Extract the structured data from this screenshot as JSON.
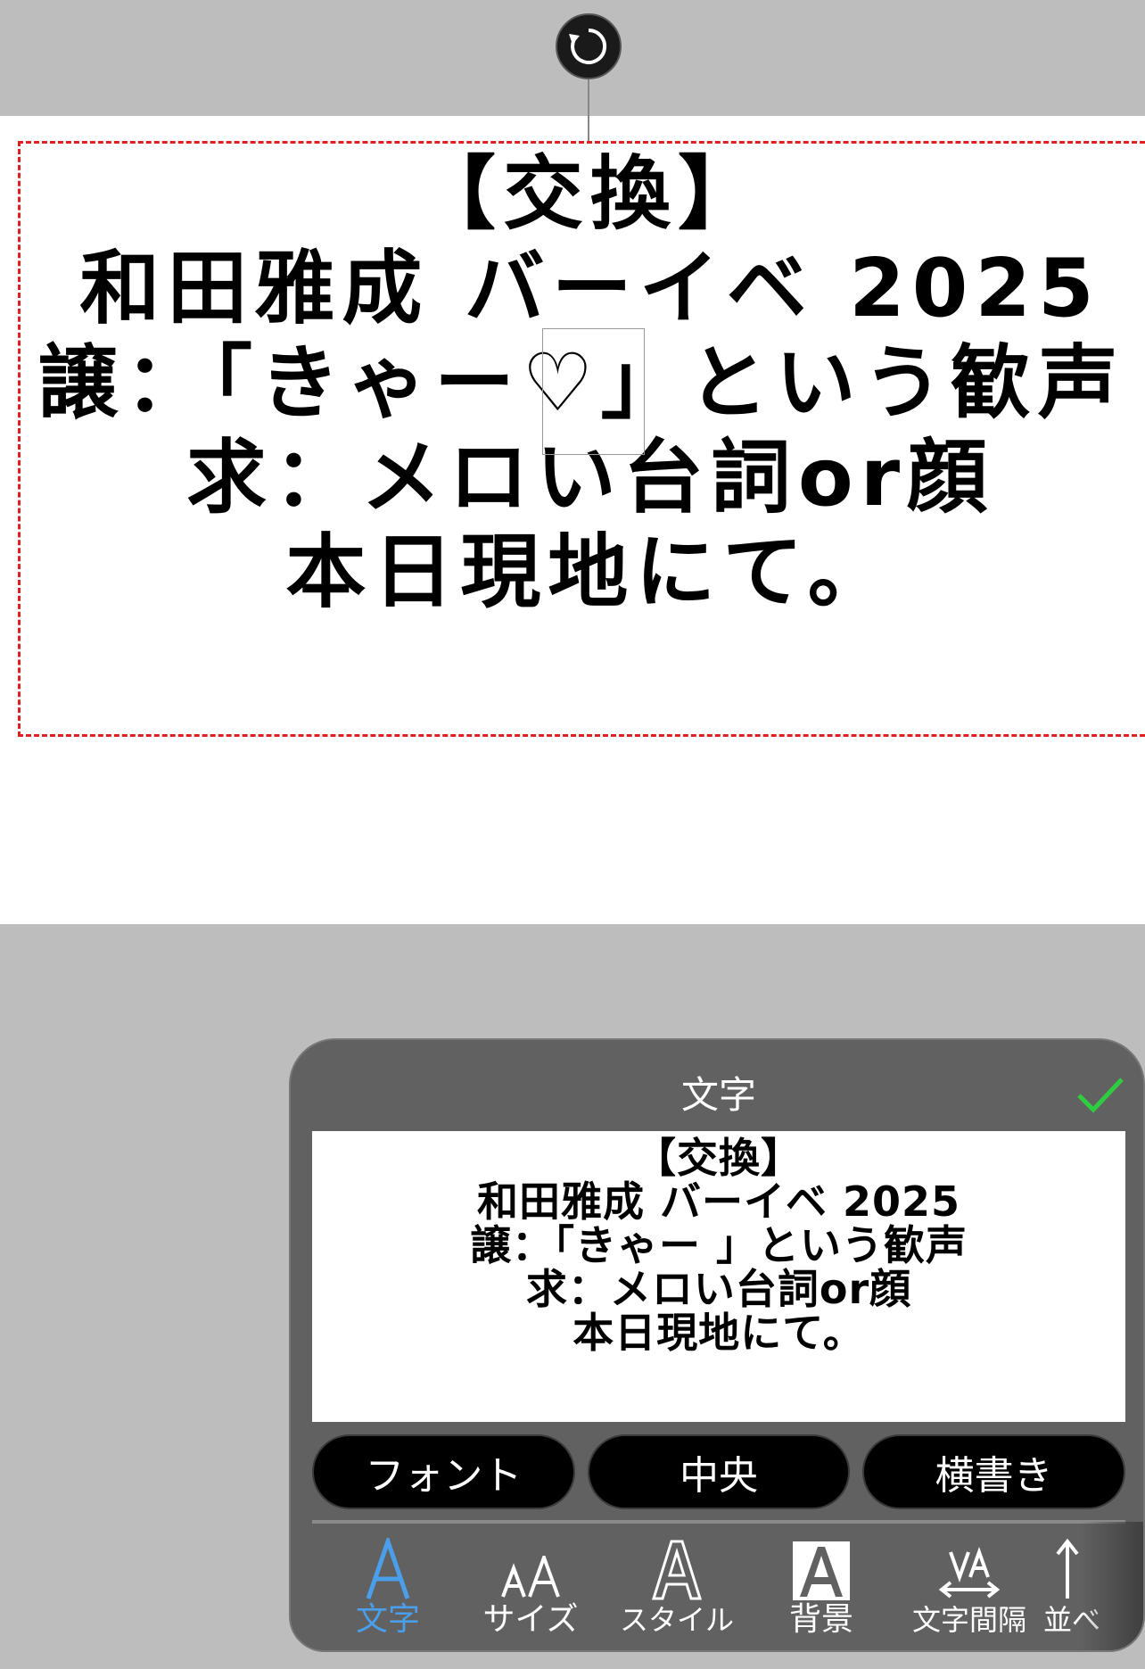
{
  "canvas": {
    "text_lines": [
      "【交換】",
      "和田雅成 バーイベ 2025",
      "譲：「きゃー♡」という歓声",
      "求：メロい台詞or顔",
      "本日現地にて。"
    ]
  },
  "panel": {
    "title": "文字",
    "preview_lines": [
      "【交換】",
      "和田雅成 バーイベ 2025",
      "譲：「きゃー 」という歓声",
      "求：メロい台詞or顔",
      "本日現地にて。"
    ],
    "buttons": {
      "font": "フォント",
      "align": "中央",
      "direction": "横書き"
    },
    "tabs": [
      {
        "label": "文字",
        "icon": "letter-a-icon"
      },
      {
        "label": "サイズ",
        "icon": "text-size-icon"
      },
      {
        "label": "スタイル",
        "icon": "outline-a-icon"
      },
      {
        "label": "背景",
        "icon": "background-a-icon"
      },
      {
        "label": "文字間隔",
        "icon": "letter-spacing-icon"
      },
      {
        "label": "並べ",
        "icon": "arrow-up-icon"
      }
    ],
    "accent_color": "#4a9eea",
    "check_color": "#2ecc40"
  }
}
